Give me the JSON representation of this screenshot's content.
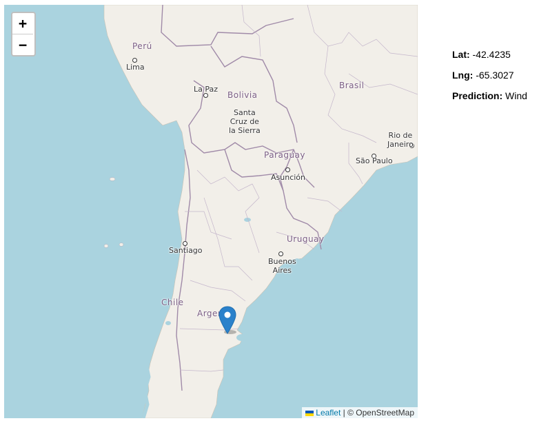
{
  "map": {
    "countries": {
      "peru": "Perú",
      "bolivia": "Bolivia",
      "brasil": "Brasil",
      "paraguay": "Paraguay",
      "uruguay": "Uruguay",
      "chile": "Chile",
      "argentina": "Argen"
    },
    "cities": {
      "lima": "Lima",
      "la_paz": "La Paz",
      "santa_cruz": "Santa\nCruz de\nla Sierra",
      "asuncion": "Asunción",
      "sao_paulo": "São Paulo",
      "rio": "Rio de\nJaneiro",
      "santiago": "Santiago",
      "buenos_aires": "Buenos\nAires"
    },
    "zoom_in": "+",
    "zoom_out": "−",
    "attribution_leaflet": "Leaflet",
    "attribution_rest": " | © OpenStreetMap",
    "colors": {
      "water": "#aad3df",
      "land": "#f2efe9",
      "border": "#a08aa8",
      "marker": "#2a81cb"
    }
  },
  "info": {
    "lat_label": "Lat:",
    "lat_value": " -42.4235",
    "lng_label": "Lng:",
    "lng_value": " -65.3027",
    "prediction_label": "Prediction:",
    "prediction_value": " Wind"
  }
}
